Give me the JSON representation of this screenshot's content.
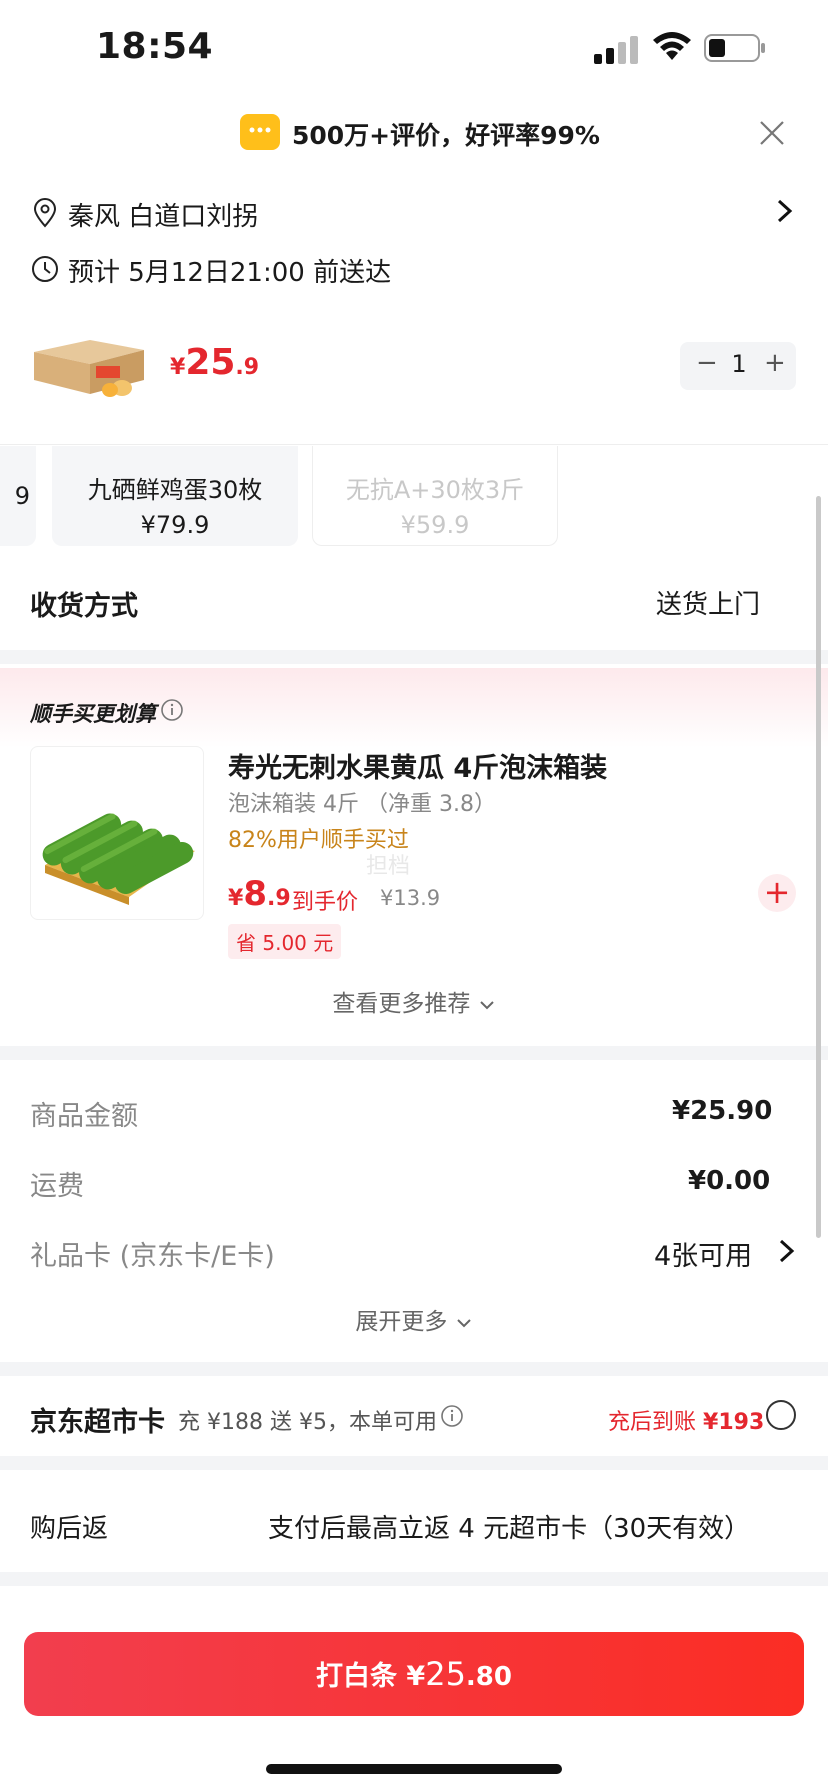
{
  "status_bar": {
    "time": "18:54"
  },
  "banner": {
    "text": "500万+评价，好评率99%"
  },
  "address": {
    "text": "秦风  白道口刘拐"
  },
  "delivery_eta": {
    "text": "预计 5月12日21:00 前送达"
  },
  "product": {
    "currency": "¥",
    "price_int": "25",
    "price_dec": ".9",
    "quantity": "1",
    "minus": "−",
    "plus": "+"
  },
  "specs": [
    {
      "name": "",
      "price": "9"
    },
    {
      "name": "九硒鲜鸡蛋30枚",
      "price": "¥79.9"
    },
    {
      "name": "无抗A+30枚3斤",
      "price": "¥59.9"
    }
  ],
  "delivery_method": {
    "label": "收货方式",
    "value": "送货上门"
  },
  "addon": {
    "title": "顺手买更划算",
    "name": "寿光无刺水果黄瓜 4斤泡沫箱装",
    "spec": "泡沫箱装 4斤  （净重 3.8）",
    "users": "82%用户顺手买过",
    "watermark": "担档",
    "currency": "¥",
    "price_int": "8",
    "price_dec": ".9",
    "price_label": "到手价",
    "orig_price": "¥13.9",
    "save": "省 5.00 元",
    "add": "+",
    "more": "查看更多推荐"
  },
  "amounts": {
    "goods_label": "商品金额",
    "goods_value": "¥25.90",
    "freight_label": "运费",
    "freight_value": "¥0.00",
    "giftcard_label": "礼品卡 (京东卡/E卡)",
    "giftcard_value": "4张可用",
    "expand": "展开更多"
  },
  "jd_card": {
    "title": "京东超市卡",
    "desc": "充 ¥188 送 ¥5，本单可用",
    "after_label": "充后到账",
    "after_value": "¥193"
  },
  "return": {
    "label": "购后返",
    "value": "支付后最高立返 4 元超市卡（30天有效）"
  },
  "pay_button": {
    "label": "打白条",
    "currency": "¥",
    "amount_int": "25",
    "amount_dec": ".80"
  },
  "colors": {
    "accent": "#e4272e",
    "pay_gradient_start": "#f23e4e",
    "pay_gradient_end": "#fb2d24",
    "banner_icon": "#ffbf1a"
  }
}
